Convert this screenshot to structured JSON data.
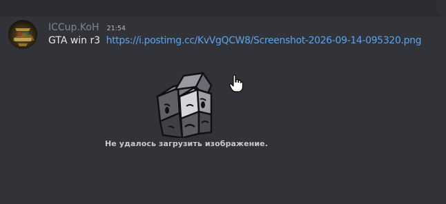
{
  "message": {
    "username": "ICCup.KoH",
    "timestamp": "21:54",
    "text": "GTA win r3",
    "link": "https://i.postimg.cc/KvVgQCW8/Screenshot-2026-09-14-095320.png"
  },
  "embed": {
    "error_text": "Не удалось загрузить изображение."
  },
  "colors": {
    "background": "#323338",
    "topbar": "#2b2c30",
    "username": "#7d8590",
    "link": "#5da3ec",
    "text": "#e8e9ec"
  },
  "icons": {
    "avatar": "avatar-image",
    "error": "broken-cube-icon",
    "cursor": "hand-pointer-cursor"
  }
}
